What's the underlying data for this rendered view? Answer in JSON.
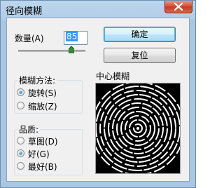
{
  "window": {
    "title": "径向模糊"
  },
  "amount": {
    "label": "数量(A)",
    "value": "85",
    "max": "100"
  },
  "buttons": {
    "ok_label": "确定",
    "reset_label": "复位"
  },
  "blur_method": {
    "title": "模糊方法:",
    "options": [
      {
        "label": "旋转(S)",
        "checked": true
      },
      {
        "label": "缩放(Z)",
        "checked": false
      }
    ]
  },
  "quality": {
    "title": "品质:",
    "options": [
      {
        "label": "草图(D)",
        "checked": false
      },
      {
        "label": "好(G)",
        "checked": true
      },
      {
        "label": "最好(B)",
        "checked": false
      }
    ]
  },
  "preview": {
    "title": "中心模糊"
  },
  "colors": {
    "titlebar": "#b3cde6",
    "client": "#f0f0f0",
    "close": "#c23b22",
    "selection": "#3399ff"
  }
}
